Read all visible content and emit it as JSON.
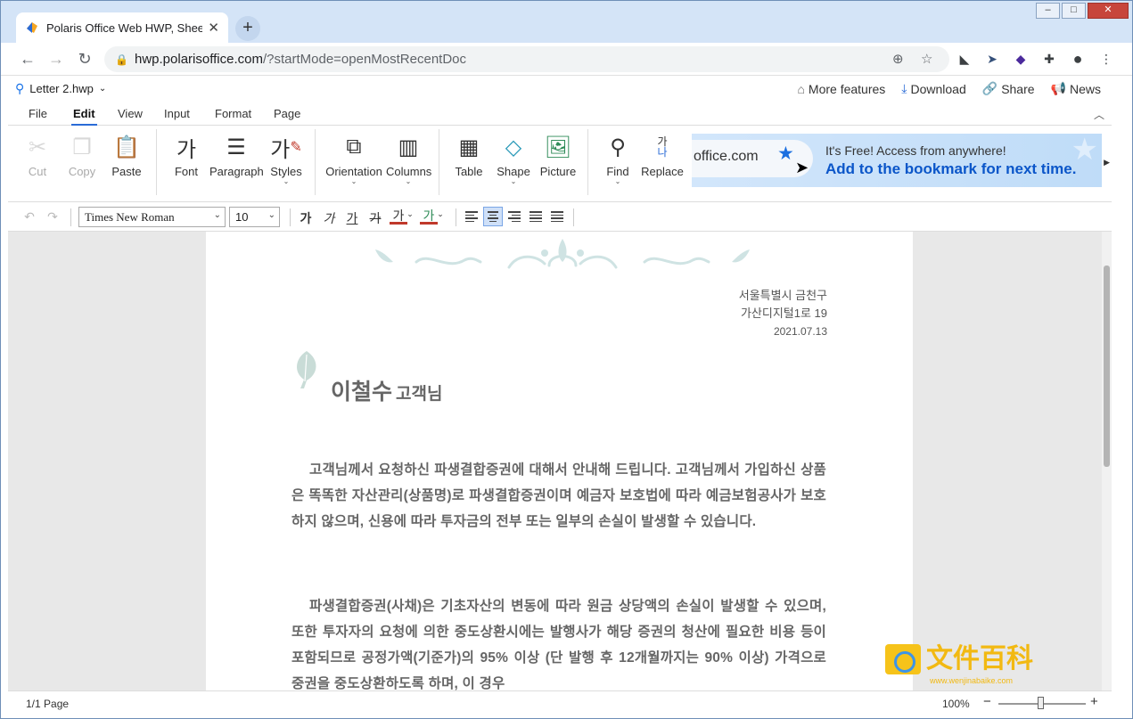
{
  "browser": {
    "tab_title": "Polaris Office Web HWP, Shee",
    "new_tab": "+",
    "url_host": "hwp.polarisoffice.com",
    "url_path": "/?startMode=openMostRecentDoc",
    "window_controls": {
      "minimize": "–",
      "maximize": "□",
      "close": "✕"
    }
  },
  "app": {
    "doc_name": "Letter 2.hwp",
    "header_links": [
      "More features",
      "Download",
      "Share",
      "News"
    ],
    "menu_tabs": [
      "File",
      "Edit",
      "View",
      "Input",
      "Format",
      "Page"
    ],
    "active_menu": "Edit"
  },
  "ribbon": {
    "buttons": {
      "cut": "Cut",
      "copy": "Copy",
      "paste": "Paste",
      "font": "Font",
      "paragraph": "Paragraph",
      "styles": "Styles",
      "orientation": "Orientation",
      "columns": "Columns",
      "table": "Table",
      "shape": "Shape",
      "picture": "Picture",
      "find": "Find",
      "replace": "Replace"
    },
    "glyphs": {
      "font": "가",
      "styles": "가",
      "replace_top": "가",
      "replace_bottom": "나"
    },
    "banner": {
      "url_fragment": "office.com",
      "line1": "It's Free! Access from anywhere!",
      "line2": "Add to the bookmark for next time."
    }
  },
  "format_bar": {
    "font_family": "Times New Roman",
    "font_size": "10",
    "char_buttons": [
      "가",
      "가",
      "가",
      "가",
      "가",
      "가"
    ]
  },
  "document": {
    "address_line1": "서울특별시 금천구",
    "address_line2": "가산디지털1로 19",
    "date": "2021.07.13",
    "greeting_name": "이철수",
    "greeting_suffix": "고객님",
    "paragraph1": "고객님께서 요청하신 파생결합증권에 대해서 안내해 드립니다. 고객님께서 가입하신 상품은 똑똑한 자산관리(상품명)로 파생결합증권이며 예금자 보호법에 따라 예금보험공사가 보호하지 않으며, 신용에 따라 투자금의 전부 또는 일부의 손실이 발생할 수 있습니다.",
    "paragraph2": "파생결합증권(사채)은 기초자산의 변동에 따라 원금 상당액의 손실이 발생할 수 있으며, 또한 투자자의 요청에 의한 중도상환시에는 발행사가 해당 증권의 청산에 필요한 비용 등이 포함되므로 공정가액(기준가)의 95% 이상 (단 발행 후 12개월까지는 90% 이상) 가격으로 중권을 중도상환하도록 하며, 이 경우"
  },
  "status": {
    "page": "1/1 Page",
    "zoom": "100%",
    "zoom_level_percent": 100
  },
  "watermark": {
    "title": "文件百科",
    "url": "www.wenjinabaike.com"
  },
  "colors": {
    "accent": "#2a6bd6",
    "banner_text": "#0b56c9",
    "text_gray": "#666666"
  }
}
